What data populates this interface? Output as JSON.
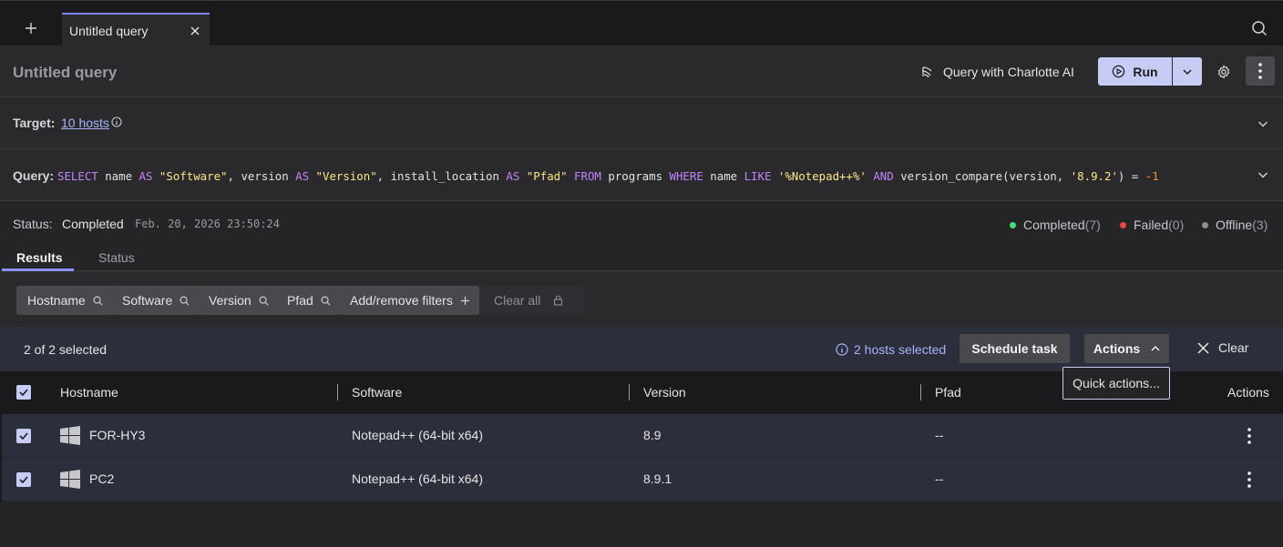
{
  "tabbar": {
    "tabs": [
      {
        "label": "Untitled query"
      }
    ]
  },
  "header": {
    "title": "Untitled query",
    "charlotte_label": "Query with Charlotte AI",
    "run_label": "Run"
  },
  "target": {
    "label": "Target:",
    "value": "10 hosts"
  },
  "query": {
    "label": "Query:",
    "tokens": [
      {
        "t": "SELECT",
        "c": "kw"
      },
      {
        "t": " name ",
        "c": ""
      },
      {
        "t": "AS",
        "c": "kw"
      },
      {
        "t": " ",
        "c": ""
      },
      {
        "t": "\"Software\"",
        "c": "str"
      },
      {
        "t": ", version ",
        "c": ""
      },
      {
        "t": "AS",
        "c": "kw"
      },
      {
        "t": " ",
        "c": ""
      },
      {
        "t": "\"Version\"",
        "c": "str"
      },
      {
        "t": ", install_location ",
        "c": ""
      },
      {
        "t": "AS",
        "c": "kw"
      },
      {
        "t": " ",
        "c": ""
      },
      {
        "t": "\"Pfad\"",
        "c": "str"
      },
      {
        "t": " ",
        "c": ""
      },
      {
        "t": "FROM",
        "c": "kw"
      },
      {
        "t": " programs ",
        "c": ""
      },
      {
        "t": "WHERE",
        "c": "kw"
      },
      {
        "t": " name ",
        "c": ""
      },
      {
        "t": "LIKE",
        "c": "kw"
      },
      {
        "t": " ",
        "c": ""
      },
      {
        "t": "'%Notepad++%'",
        "c": "str"
      },
      {
        "t": " ",
        "c": ""
      },
      {
        "t": "AND",
        "c": "kw"
      },
      {
        "t": " version_compare(version, ",
        "c": ""
      },
      {
        "t": "'8.9.2'",
        "c": "str"
      },
      {
        "t": ") = ",
        "c": ""
      },
      {
        "t": "-1",
        "c": "num"
      }
    ]
  },
  "status": {
    "label": "Status:",
    "value": "Completed",
    "timestamp": "Feb. 20, 2026 23:50:24",
    "legend": [
      {
        "label": "Completed",
        "count": "(7)",
        "color": "#4ade80"
      },
      {
        "label": "Failed",
        "count": "(0)",
        "color": "#ef4444"
      },
      {
        "label": "Offline",
        "count": "(3)",
        "color": "#8e8e93"
      }
    ]
  },
  "view_tabs": {
    "results": "Results",
    "status": "Status"
  },
  "filters": {
    "chips": [
      "Hostname",
      "Software",
      "Version",
      "Pfad"
    ],
    "add_label": "Add/remove filters",
    "clear_all_label": "Clear all"
  },
  "selection": {
    "count_text": "2 of 2 selected",
    "hosts_selected": "2 hosts selected",
    "schedule_label": "Schedule task",
    "actions_label": "Actions",
    "clear_label": "Clear",
    "dropdown_item": "Quick actions..."
  },
  "table": {
    "columns": [
      "Hostname",
      "Software",
      "Version",
      "Pfad",
      "Actions"
    ],
    "rows": [
      {
        "hostname": "FOR-HY3",
        "software": "Notepad++ (64-bit x64)",
        "version": "8.9",
        "pfad": "--"
      },
      {
        "hostname": "PC2",
        "software": "Notepad++ (64-bit x64)",
        "version": "8.9.1",
        "pfad": "--"
      }
    ]
  },
  "colors": {
    "accent": "#8b92ff",
    "primary_button": "#c7ccf5",
    "link": "#a5b4fc",
    "selection_bg": "#2c2e3b"
  }
}
